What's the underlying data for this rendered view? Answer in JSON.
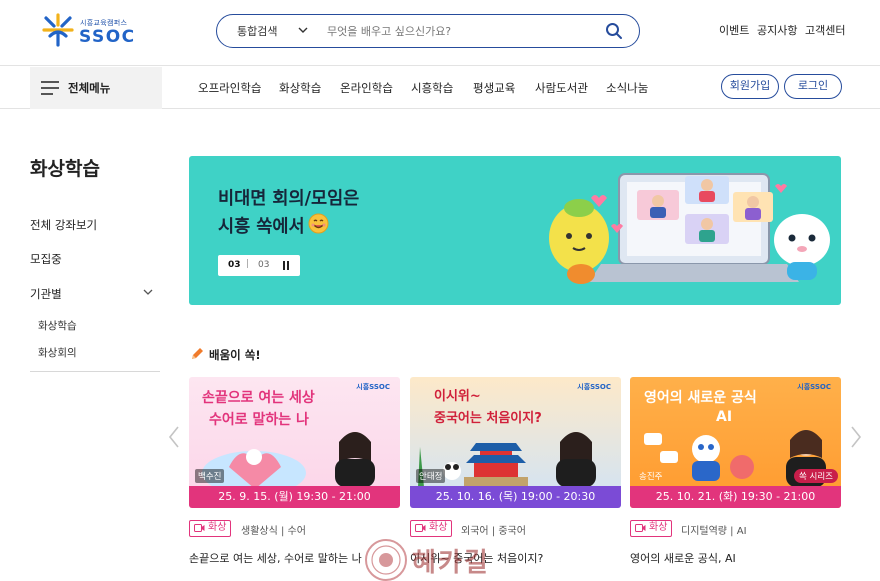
{
  "header": {
    "logo_small": "시흥교육캠퍼스",
    "logo_big": "SSOC",
    "search": {
      "scope": "통합검색",
      "placeholder": "무엇을 배우고 싶으신가요?"
    },
    "utility": [
      "이벤트",
      "공지사항",
      "고객센터"
    ]
  },
  "nav": {
    "all_menu": "전체메뉴",
    "items": [
      "오프라인학습",
      "화상학습",
      "온라인학습",
      "시흥학습",
      "평생교육",
      "사람도서관",
      "소식나눔"
    ],
    "signup": "회원가입",
    "login": "로그인"
  },
  "sidebar": {
    "title": "화상학습",
    "items": [
      "전체 강좌보기",
      "모집중",
      "기관별"
    ],
    "subitems": [
      "화상학습",
      "화상회의"
    ]
  },
  "banner": {
    "line1": "비대면 회의/모임은",
    "line2": "시흥 쏙에서",
    "current": "03",
    "separator": "|",
    "total": "03",
    "bg": "#3fd2c6"
  },
  "section": {
    "title": "배움이 쏙!"
  },
  "cards": [
    {
      "image_title_1": "손끝으로 여는 세상",
      "image_title_2": "수어로 말하는 나",
      "instructor": "백수진",
      "schedule": "25. 9. 15. (월) 19:30 - 21:00",
      "tag": "화상",
      "category": "생활상식 | 수어",
      "title": "손끝으로 여는 세상, 수어로 말하는 나",
      "brand": "시흥SSOC"
    },
    {
      "image_title_1": "이시위~",
      "image_title_2": "중국어는 처음이지?",
      "instructor": "안태정",
      "schedule": "25. 10. 16. (목) 19:00 - 20:30",
      "tag": "화상",
      "category": "외국어 | 중국어",
      "title": "이시위~ 중국어는 처음이지?",
      "brand": "시흥SSOC"
    },
    {
      "image_title_1": "영어의 새로운 공식",
      "image_title_2": "AI",
      "instructor": "송진주",
      "series": "쏙 시리즈",
      "schedule": "25. 10. 21. (화) 19:30 - 21:00",
      "tag": "화상",
      "category": "디지털역량 | AI",
      "title": "영어의 새로운 공식, AI",
      "brand": "시흥SSOC"
    }
  ],
  "watermark": "혜카길"
}
